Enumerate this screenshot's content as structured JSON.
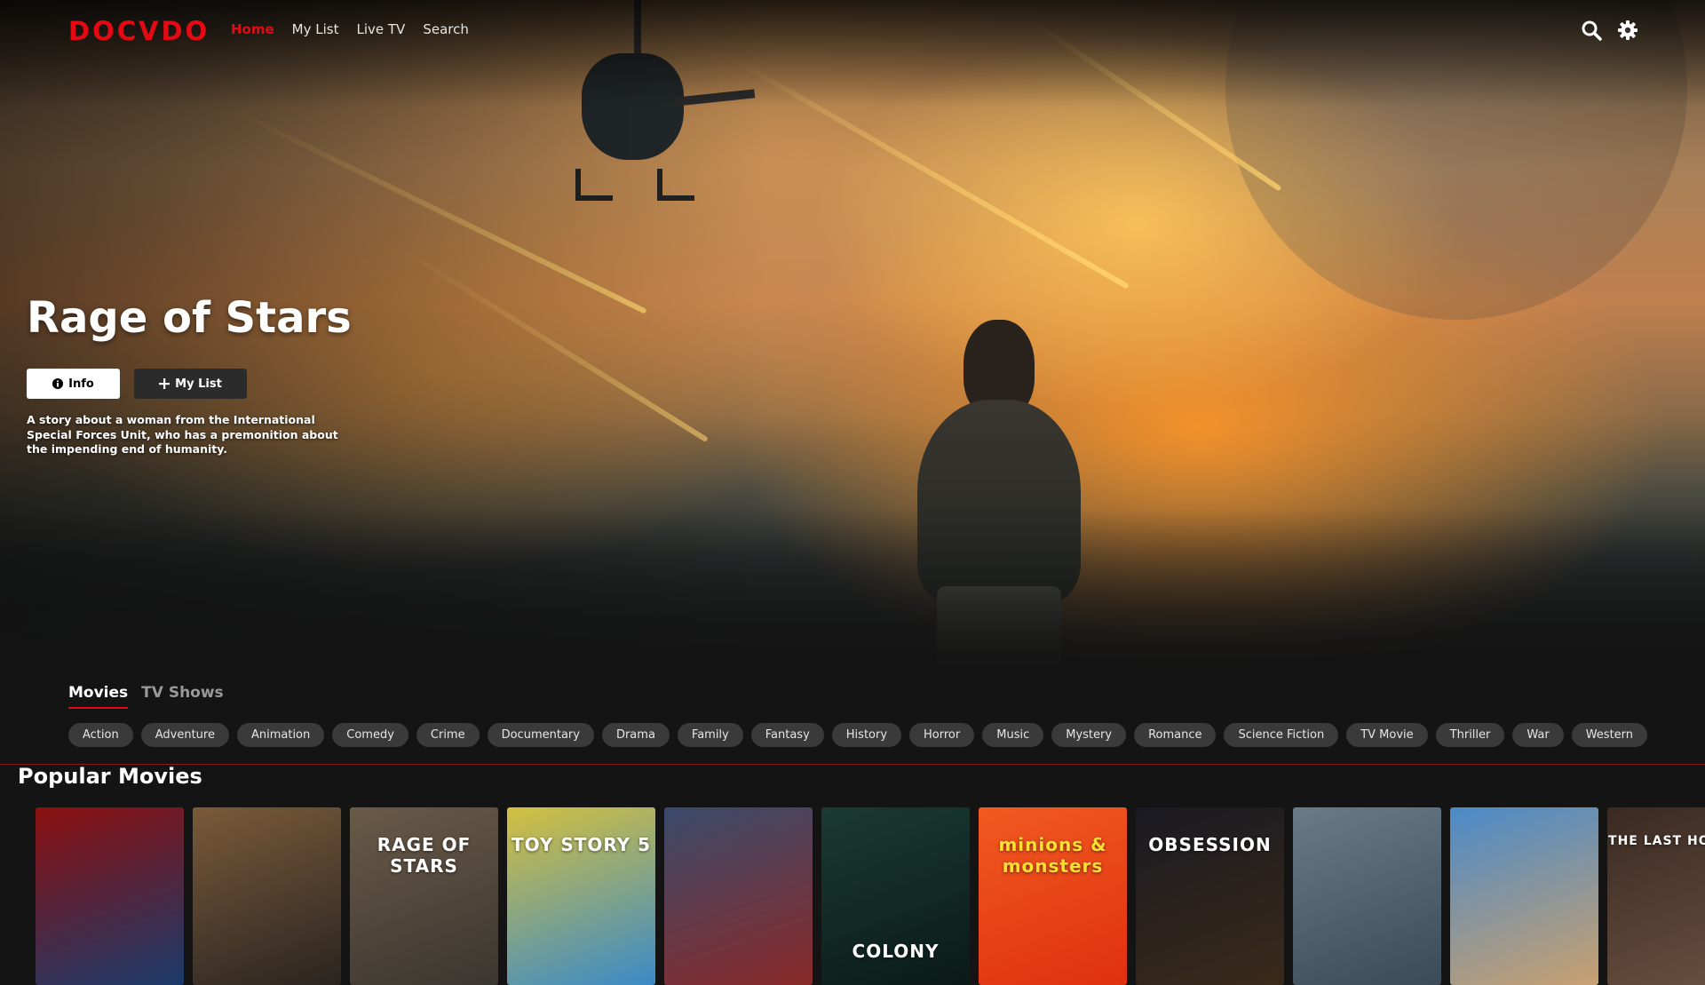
{
  "app": {
    "logo": "DOCVDO",
    "accent_color": "#e50914"
  },
  "nav": {
    "links": [
      {
        "label": "Home",
        "active": true
      },
      {
        "label": "My List",
        "active": false
      },
      {
        "label": "Live TV",
        "active": false
      },
      {
        "label": "Search",
        "active": false
      }
    ],
    "icons": [
      "search-icon",
      "gear-icon"
    ]
  },
  "hero": {
    "title": "Rage of Stars",
    "info_label": "Info",
    "mylist_label": "My List",
    "description": "A story about a woman from the International Special Forces Unit, who has a premonition about the impending end of humanity."
  },
  "tabs": [
    {
      "label": "Movies",
      "active": true
    },
    {
      "label": "TV Shows",
      "active": false
    }
  ],
  "genres": [
    "Action",
    "Adventure",
    "Animation",
    "Comedy",
    "Crime",
    "Documentary",
    "Drama",
    "Family",
    "Fantasy",
    "History",
    "Horror",
    "Music",
    "Mystery",
    "Romance",
    "Science Fiction",
    "TV Movie",
    "Thriller",
    "War",
    "Western"
  ],
  "popular": {
    "title": "Popular Movies",
    "posters": [
      {
        "text": "",
        "colors": [
          "#8b1010",
          "#1a3a6a"
        ]
      },
      {
        "text": "",
        "colors": [
          "#7a5a3a",
          "#2a2420"
        ]
      },
      {
        "text": "RAGE OF STARS",
        "colors": [
          "#6a5a48",
          "#3a3630"
        ]
      },
      {
        "text": "TOY STORY 5",
        "colors": [
          "#d4c040",
          "#3a8ac8"
        ]
      },
      {
        "text": "",
        "colors": [
          "#3a4a6a",
          "#8a2a2a"
        ]
      },
      {
        "text": "COLONY",
        "colors": [
          "#1a3a32",
          "#0a1a18"
        ]
      },
      {
        "text": "minions & monsters",
        "colors": [
          "#f05a20",
          "#e03010"
        ]
      },
      {
        "text": "OBSESSION",
        "colors": [
          "#1a1a22",
          "#3a2a1a"
        ]
      },
      {
        "text": "",
        "colors": [
          "#6a7a88",
          "#3a4a58"
        ]
      },
      {
        "text": "",
        "colors": [
          "#4a8ac8",
          "#c8a070"
        ]
      },
      {
        "text": "THE LAST HOLIDAY",
        "colors": [
          "#3a2a22",
          "#6a5040"
        ]
      }
    ]
  }
}
